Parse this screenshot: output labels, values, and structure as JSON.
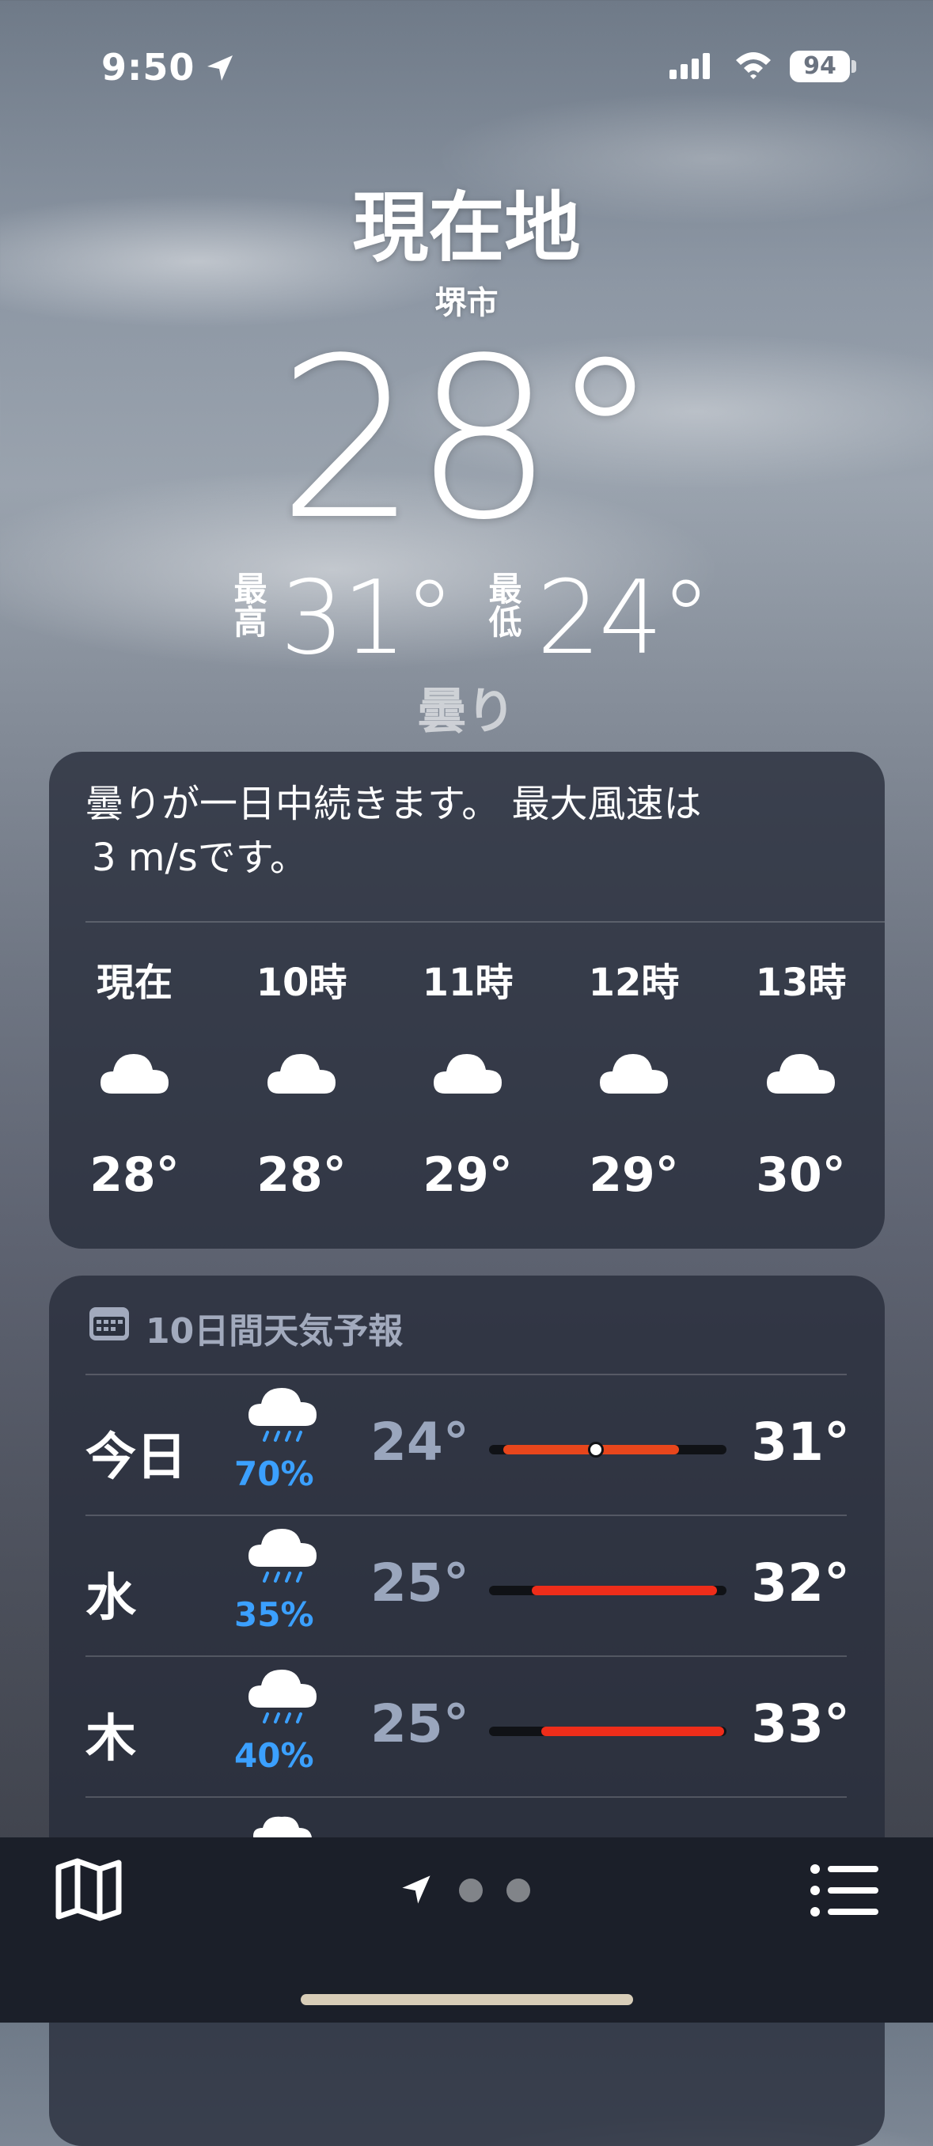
{
  "status_bar": {
    "time": "9:50",
    "battery": "94"
  },
  "header": {
    "location_title": "現在地",
    "city": "堺市",
    "current_temp": "28°",
    "high_label": "最高",
    "high_temp": "31°",
    "low_label": "最低",
    "low_temp": "24°",
    "condition": "曇り"
  },
  "hourly": {
    "summary_line1": "曇りが一日中続きます。 最大風速は",
    "summary_line2": "3 m/sです。",
    "hours": [
      {
        "label": "現在",
        "icon": "cloud-icon",
        "temp": "28°"
      },
      {
        "label": "10時",
        "icon": "cloud-icon",
        "temp": "28°"
      },
      {
        "label": "11時",
        "icon": "cloud-icon",
        "temp": "29°"
      },
      {
        "label": "12時",
        "icon": "cloud-icon",
        "temp": "29°"
      },
      {
        "label": "13時",
        "icon": "cloud-icon",
        "temp": "30°"
      }
    ]
  },
  "daily": {
    "title": "10日間天気予報",
    "days": [
      {
        "day": "今日",
        "icon": "rain-cloud-icon",
        "precip": "70%",
        "low": "24°",
        "high": "31°",
        "bar_start": 0.06,
        "bar_end": 0.8,
        "current_marker": 0.45,
        "bar_color": "#e8461c"
      },
      {
        "day": "水",
        "icon": "rain-cloud-icon",
        "precip": "35%",
        "low": "25°",
        "high": "32°",
        "bar_start": 0.18,
        "bar_end": 0.96,
        "bar_color": "#ee2d1a"
      },
      {
        "day": "木",
        "icon": "rain-cloud-icon",
        "precip": "40%",
        "low": "25°",
        "high": "33°",
        "bar_start": 0.22,
        "bar_end": 0.99,
        "bar_color": "#ee2d1a"
      }
    ]
  },
  "bottom_bar": {
    "map_icon": "map-icon",
    "list_icon": "list-icon"
  },
  "colors": {
    "precip_blue": "#3ba0ff",
    "bar_red": "#ee2d1a",
    "bar_orange": "#e8461c"
  }
}
